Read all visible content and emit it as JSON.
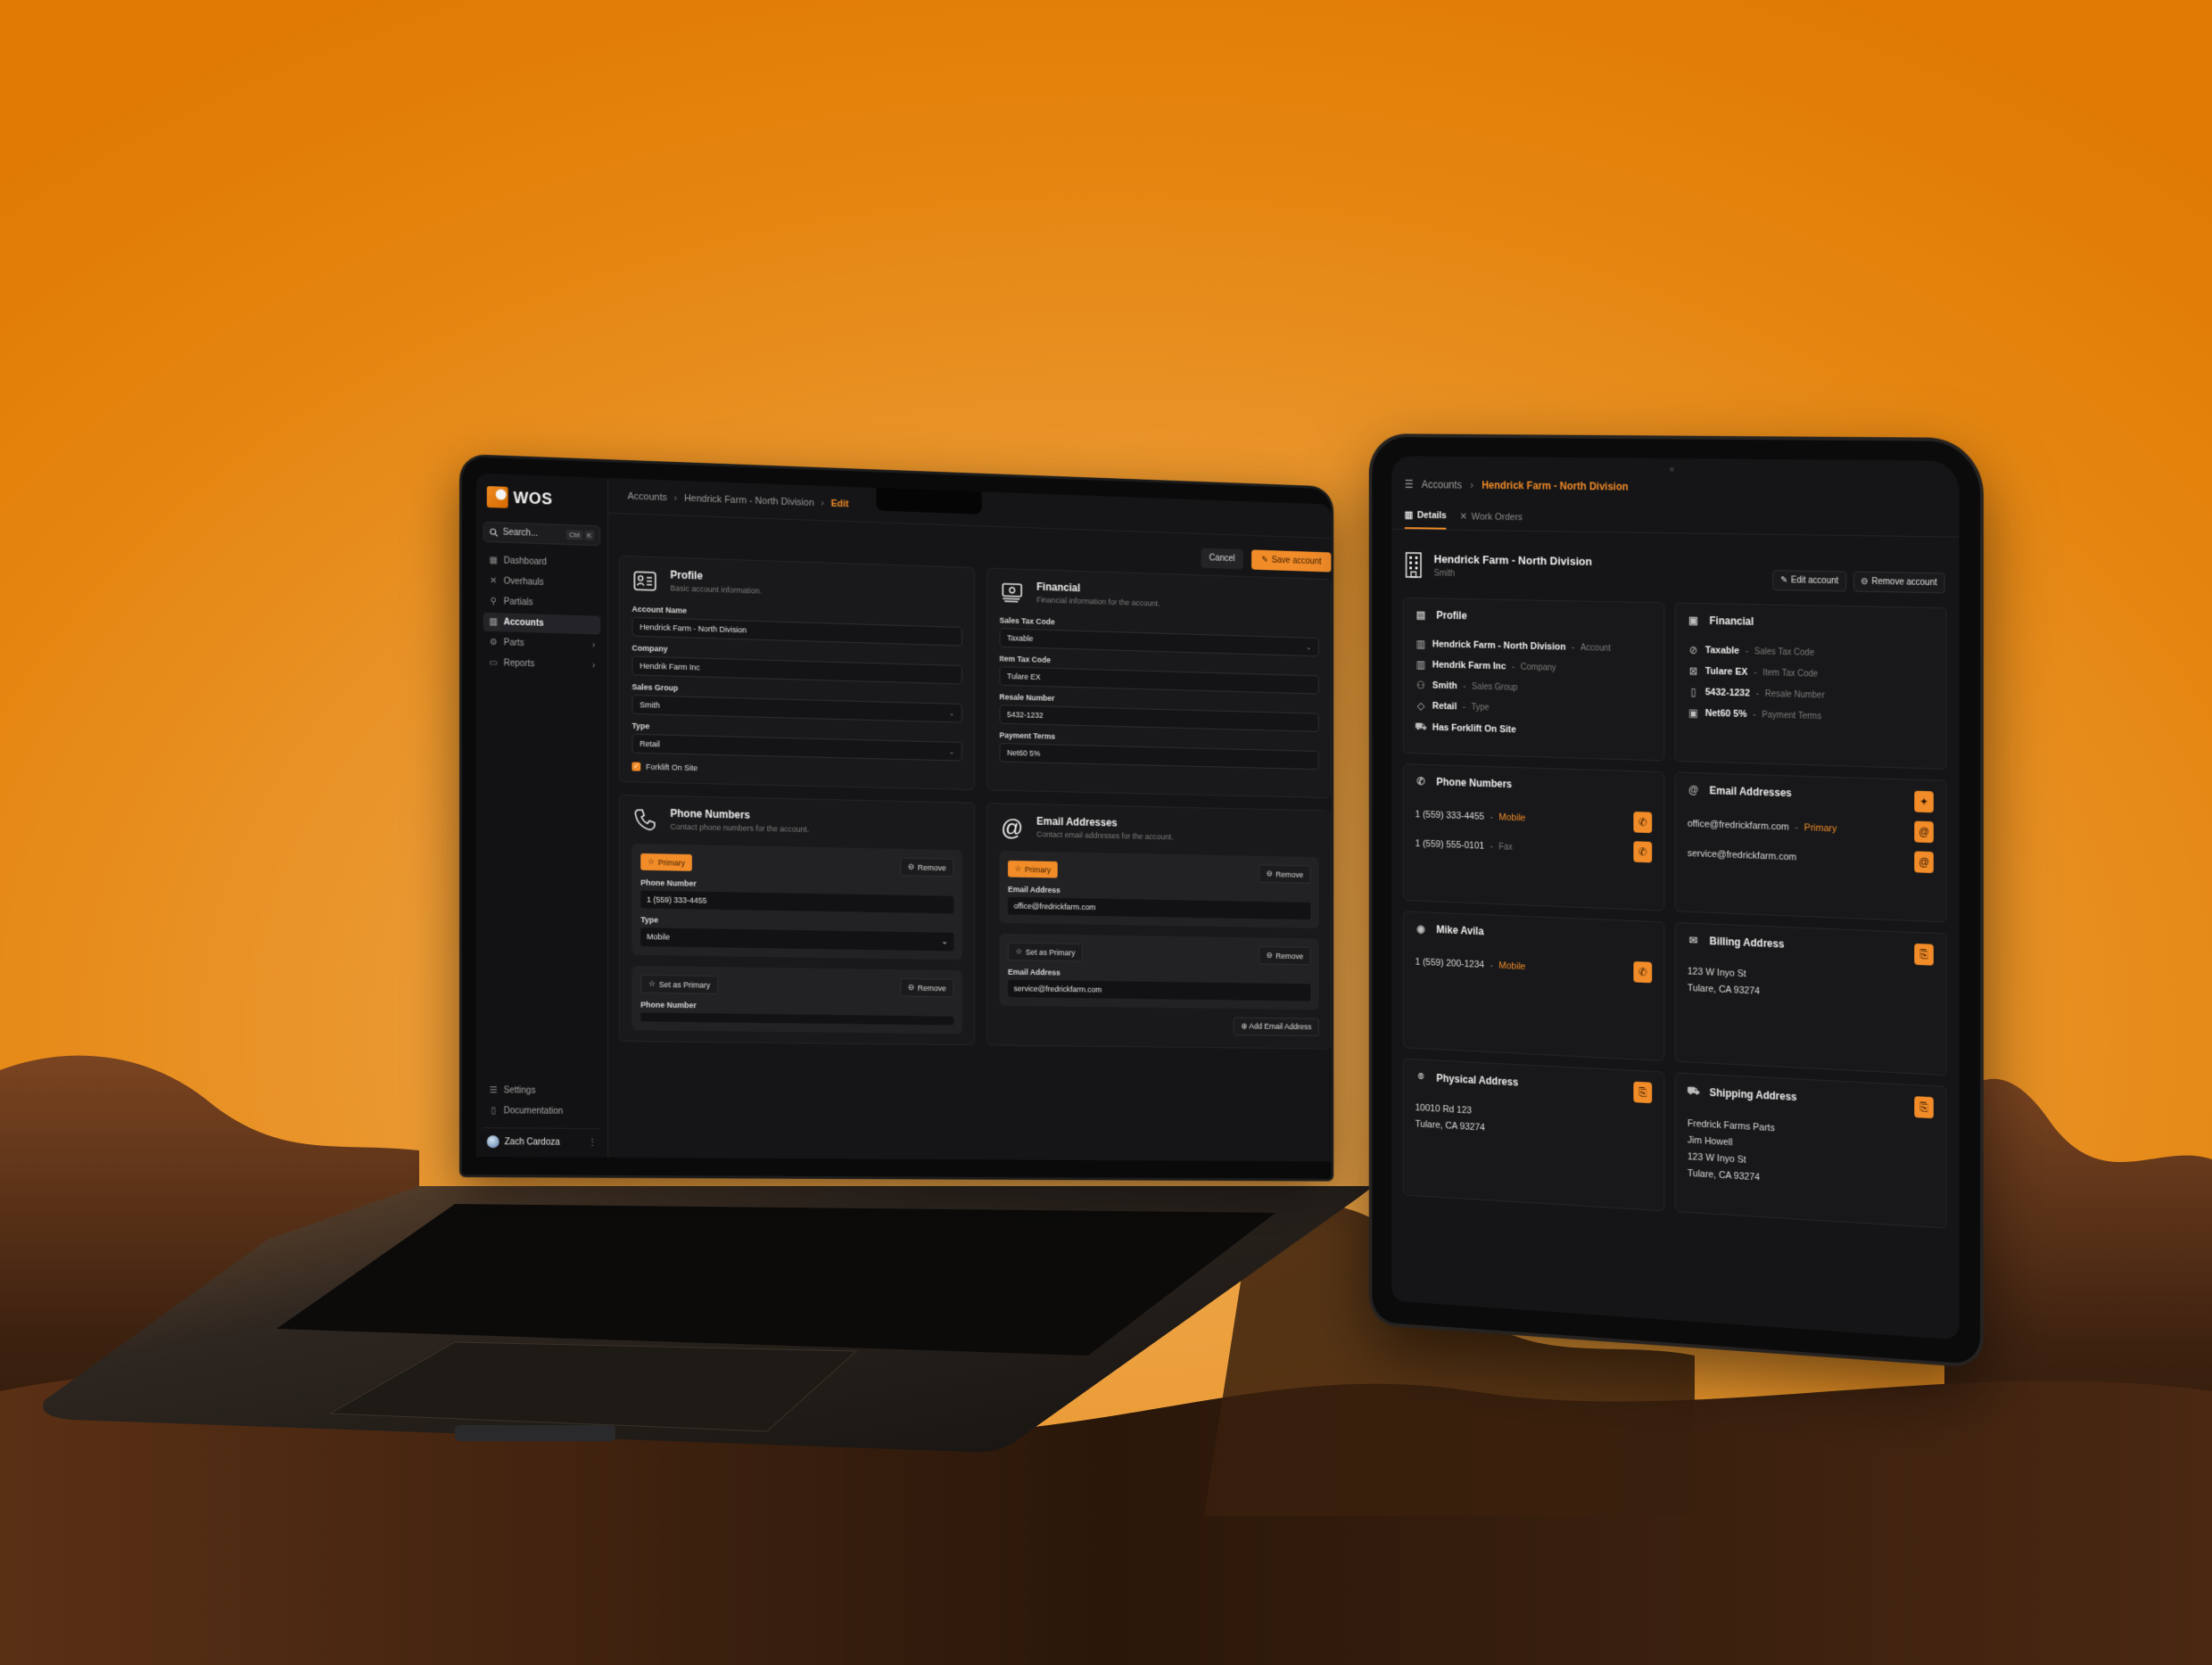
{
  "colors": {
    "accent": "#f28c28",
    "background_orange": "#e5850f",
    "screen_bg": "#151517",
    "card_bg": "#19191b"
  },
  "laptop": {
    "app": {
      "brand": "WOS",
      "search_placeholder": "Search...",
      "search_shortcut": [
        "Ctrl",
        "K"
      ]
    },
    "sidebar": {
      "items": [
        {
          "label": "Dashboard",
          "icon": "dashboard-icon"
        },
        {
          "label": "Overhauls",
          "icon": "tools-icon"
        },
        {
          "label": "Partials",
          "icon": "wrench-icon"
        },
        {
          "label": "Accounts",
          "icon": "building-icon",
          "active": true
        },
        {
          "label": "Parts",
          "icon": "gear-icon",
          "expandable": true
        },
        {
          "label": "Reports",
          "icon": "report-icon",
          "expandable": true
        }
      ],
      "footer": [
        {
          "label": "Settings",
          "icon": "settings-icon"
        },
        {
          "label": "Documentation",
          "icon": "book-icon"
        }
      ],
      "user": {
        "name": "Zach Cardoza"
      }
    },
    "breadcrumb": [
      "Accounts",
      "Hendrick Farm - North Division",
      "Edit"
    ],
    "actions": {
      "cancel": "Cancel",
      "save": "Save account"
    },
    "profile": {
      "title": "Profile",
      "subtitle": "Basic account information.",
      "fields": {
        "account_name": {
          "label": "Account Name",
          "value": "Hendrick Farm - North Division"
        },
        "company": {
          "label": "Company",
          "value": "Hendrik Farm Inc"
        },
        "sales_group": {
          "label": "Sales Group",
          "value": "Smith"
        },
        "type": {
          "label": "Type",
          "value": "Retail"
        }
      },
      "forklift": {
        "label": "Forklift On Site",
        "checked": true
      }
    },
    "financial": {
      "title": "Financial",
      "subtitle": "Financial information for the account.",
      "fields": {
        "sales_tax_code": {
          "label": "Sales Tax Code",
          "value": "Taxable"
        },
        "item_tax_code": {
          "label": "Item Tax Code",
          "value": "Tulare EX"
        },
        "resale_number": {
          "label": "Resale Number",
          "value": "5432-1232"
        },
        "payment_terms": {
          "label": "Payment Terms",
          "value": "Net60 5%"
        }
      }
    },
    "phones": {
      "title": "Phone Numbers",
      "subtitle": "Contact phone numbers for the account.",
      "primary_label": "Primary",
      "set_primary_label": "Set as Primary",
      "remove_label": "Remove",
      "number_label": "Phone Number",
      "type_label": "Type",
      "entries": [
        {
          "number": "1 (559) 333-4455",
          "type": "Mobile",
          "primary": true
        },
        {
          "number": "",
          "type": "",
          "primary": false
        }
      ]
    },
    "emails": {
      "title": "Email Addresses",
      "subtitle": "Contact email addresses for the account.",
      "primary_label": "Primary",
      "set_primary_label": "Set as Primary",
      "remove_label": "Remove",
      "address_label": "Email Address",
      "add_label": "Add Email Address",
      "entries": [
        {
          "address": "office@fredrickfarm.com",
          "primary": true
        },
        {
          "address": "service@fredrickfarm.com",
          "primary": false
        }
      ]
    }
  },
  "tablet": {
    "breadcrumb": [
      "Accounts",
      "Hendrick Farm - North Division"
    ],
    "tabs": [
      {
        "label": "Details",
        "active": true
      },
      {
        "label": "Work Orders",
        "active": false
      }
    ],
    "account": {
      "name": "Hendrick Farm - North Division",
      "sales_group": "Smith"
    },
    "actions": {
      "edit": "Edit account",
      "remove": "Remove account"
    },
    "profile": {
      "title": "Profile",
      "rows": [
        {
          "value": "Hendrick Farm - North Division",
          "label": "Account"
        },
        {
          "value": "Hendrik Farm Inc",
          "label": "Company"
        },
        {
          "value": "Smith",
          "label": "Sales Group"
        },
        {
          "value": "Retail",
          "label": "Type"
        },
        {
          "value": "Has Forklift On Site",
          "label": ""
        }
      ]
    },
    "financial": {
      "title": "Financial",
      "rows": [
        {
          "value": "Taxable",
          "label": "Sales Tax Code"
        },
        {
          "value": "Tulare EX",
          "label": "Item Tax Code"
        },
        {
          "value": "5432-1232",
          "label": "Resale Number"
        },
        {
          "value": "Net60 5%",
          "label": "Payment Terms"
        }
      ]
    },
    "phones": {
      "title": "Phone Numbers",
      "rows": [
        {
          "number": "1 (559) 333-4455",
          "type": "Mobile"
        },
        {
          "number": "1 (559) 555-0101",
          "type": "Fax"
        }
      ]
    },
    "emails": {
      "title": "Email Addresses",
      "rows": [
        {
          "address": "office@fredrickfarm.com",
          "tag": "Primary"
        },
        {
          "address": "service@fredrickfarm.com",
          "tag": ""
        }
      ]
    },
    "contact": {
      "name": "Mike Avila",
      "phone": "1 (559) 200-1234",
      "type": "Mobile"
    },
    "billing": {
      "title": "Billing Address",
      "lines": [
        "123 W Inyo St",
        "Tulare, CA 93274"
      ]
    },
    "physical": {
      "title": "Physical Address",
      "lines": [
        "10010 Rd 123",
        "Tulare, CA 93274"
      ]
    },
    "shipping": {
      "title": "Shipping Address",
      "lines": [
        "Fredrick Farms Parts",
        "Jim Howell",
        "123 W Inyo St",
        "Tulare, CA 93274"
      ]
    }
  }
}
